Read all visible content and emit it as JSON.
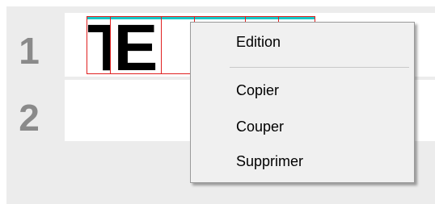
{
  "rows": [
    {
      "number": "1",
      "text": "TEXTE"
    },
    {
      "number": "2",
      "text": ""
    }
  ],
  "glyphs": [
    "T",
    "E",
    "",
    "",
    "",
    ""
  ],
  "context_menu": {
    "header": "Edition",
    "items": [
      {
        "label": "Copier"
      },
      {
        "label": "Couper"
      },
      {
        "label": "Supprimer"
      }
    ]
  },
  "colors": {
    "cell_border": "#e02020",
    "cell_baseline": "#17c7c7",
    "row_number": "#8a8a8a",
    "panel_background": "#ececec",
    "menu_background": "#f0f0f0"
  }
}
